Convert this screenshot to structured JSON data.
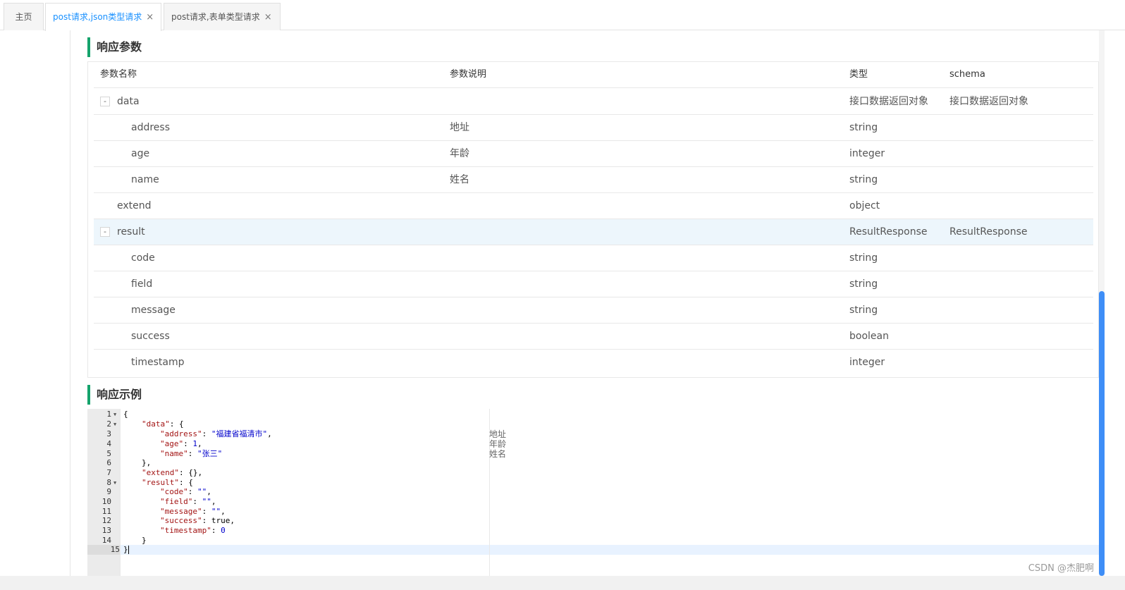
{
  "tabs": [
    {
      "label": "主页",
      "closable": false,
      "active": false
    },
    {
      "label": "post请求,json类型请求",
      "closable": true,
      "active": true
    },
    {
      "label": "post请求,表单类型请求",
      "closable": true,
      "active": false
    }
  ],
  "close_glyph": "×",
  "response_params": {
    "title": "响应参数",
    "headers": {
      "name": "参数名称",
      "desc": "参数说明",
      "type": "类型",
      "schema": "schema"
    },
    "rows": [
      {
        "name": "data",
        "desc": "",
        "type": "接口数据返回对象",
        "schema": "接口数据返回对象",
        "expander": "-"
      },
      {
        "name": "address",
        "desc": "地址",
        "type": "string",
        "schema": ""
      },
      {
        "name": "age",
        "desc": "年龄",
        "type": "integer",
        "schema": ""
      },
      {
        "name": "name",
        "desc": "姓名",
        "type": "string",
        "schema": ""
      },
      {
        "name": "extend",
        "desc": "",
        "type": "object",
        "schema": ""
      },
      {
        "name": "result",
        "desc": "",
        "type": "ResultResponse",
        "schema": "ResultResponse",
        "expander": "-"
      },
      {
        "name": "code",
        "desc": "",
        "type": "string",
        "schema": ""
      },
      {
        "name": "field",
        "desc": "",
        "type": "string",
        "schema": ""
      },
      {
        "name": "message",
        "desc": "",
        "type": "string",
        "schema": ""
      },
      {
        "name": "success",
        "desc": "",
        "type": "boolean",
        "schema": ""
      },
      {
        "name": "timestamp",
        "desc": "",
        "type": "integer",
        "schema": ""
      }
    ]
  },
  "response_example": {
    "title": "响应示例",
    "line_numbers": [
      "1",
      "2",
      "3",
      "4",
      "5",
      "6",
      "7",
      "8",
      "9",
      "10",
      "11",
      "12",
      "13",
      "14",
      "15"
    ],
    "code": {
      "l1": "{",
      "l2_key": "\"data\"",
      "l2_rest": ": {",
      "l3_key": "\"address\"",
      "l3_sep": ": ",
      "l3_val": "\"福建省福清市\"",
      "l3_end": ",",
      "l4_key": "\"age\"",
      "l4_sep": ": ",
      "l4_val": "1",
      "l4_end": ",",
      "l5_key": "\"name\"",
      "l5_sep": ": ",
      "l5_val": "\"张三\"",
      "l6": "},",
      "l7_key": "\"extend\"",
      "l7_rest": ": {},",
      "l8_key": "\"result\"",
      "l8_rest": ": {",
      "l9_key": "\"code\"",
      "l9_sep": ": ",
      "l9_val": "\"\"",
      "l9_end": ",",
      "l10_key": "\"field\"",
      "l10_sep": ": ",
      "l10_val": "\"\"",
      "l10_end": ",",
      "l11_key": "\"message\"",
      "l11_sep": ": ",
      "l11_val": "\"\"",
      "l11_end": ",",
      "l12_key": "\"success\"",
      "l12_sep": ": ",
      "l12_val": "true",
      "l12_end": ",",
      "l13_key": "\"timestamp\"",
      "l13_sep": ": ",
      "l13_val": "0",
      "l14": "}",
      "l15": "}"
    },
    "annotations": [
      "地址",
      "年龄",
      "姓名"
    ]
  },
  "watermark": "CSDN @杰肥啊"
}
